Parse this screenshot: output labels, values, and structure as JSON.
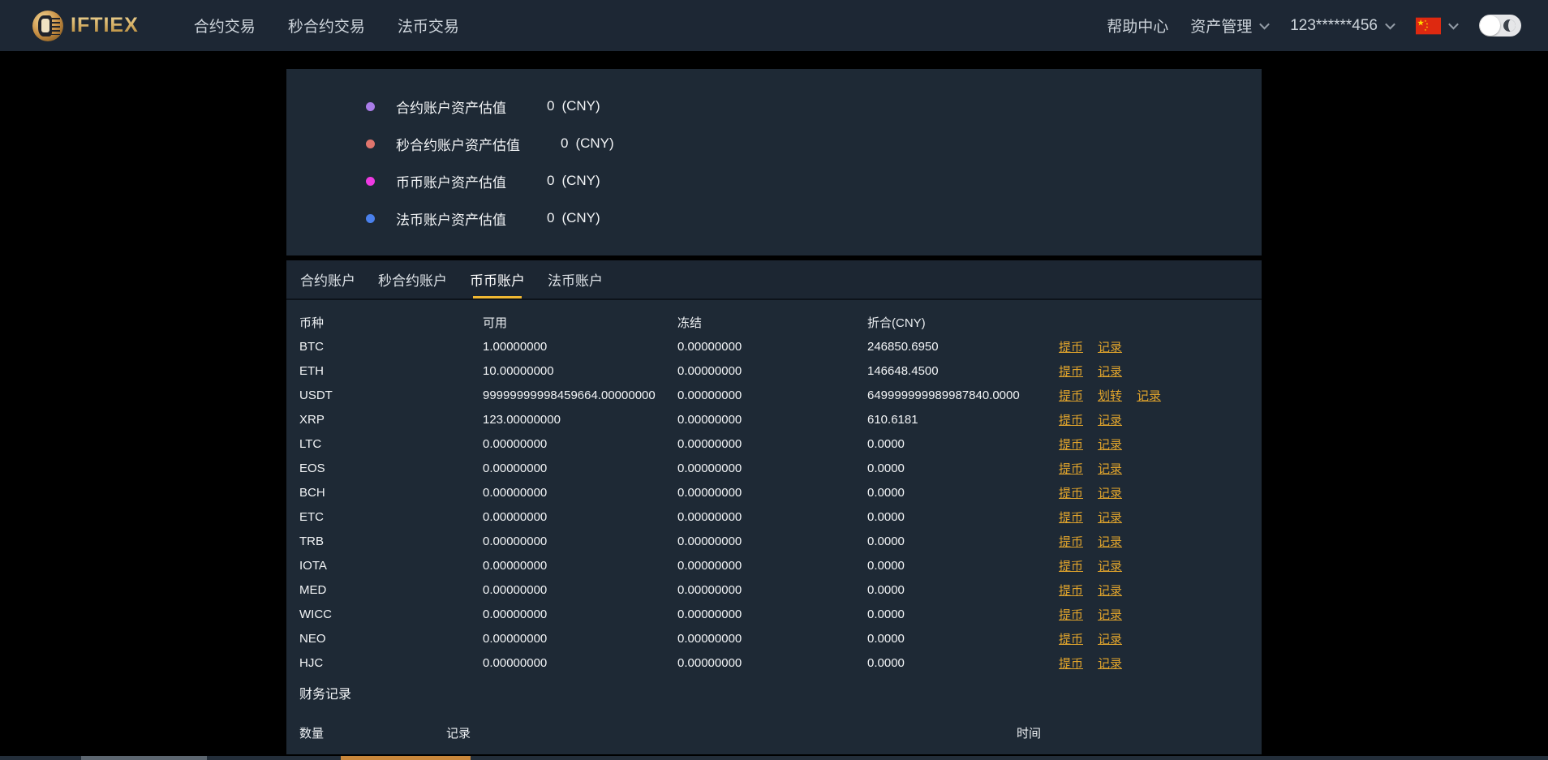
{
  "colors": {
    "page_bg": "#000000",
    "navbar_bg": "#1d2734",
    "panel_bg": "#1e2935",
    "accent_gold": "#f0b832",
    "link_gold": "#e2a52c",
    "flag_red": "#de2910",
    "flag_yellow": "#ffde00",
    "strip_gray": "#5c6670",
    "strip_orange": "#c9873b"
  },
  "navbar": {
    "brand": "IFTIEX",
    "left_items": [
      {
        "label": "合约交易"
      },
      {
        "label": "秒合约交易"
      },
      {
        "label": "法币交易"
      }
    ],
    "help": "帮助中心",
    "assets_menu": "资产管理",
    "account": "123******456"
  },
  "summary": {
    "rows": [
      {
        "label": "合约账户资产估值",
        "value": "0",
        "unit": "(CNY)",
        "dot_color": "#a97ce8"
      },
      {
        "label": "秒合约账户资产估值",
        "value": "0",
        "unit": "(CNY)",
        "dot_color": "#e0756d"
      },
      {
        "label": "币币账户资产估值",
        "value": "0",
        "unit": "(CNY)",
        "dot_color": "#ee3ae2"
      },
      {
        "label": "法币账户资产估值",
        "value": "0",
        "unit": "(CNY)",
        "dot_color": "#4a80ec"
      }
    ]
  },
  "tabs": [
    {
      "label": "合约账户",
      "active": false
    },
    {
      "label": "秒合约账户",
      "active": false
    },
    {
      "label": "币币账户",
      "active": true
    },
    {
      "label": "法币账户",
      "active": false
    }
  ],
  "balances": {
    "headers": {
      "coin": "币种",
      "available": "可用",
      "frozen": "冻结",
      "cny": "折合(CNY)"
    },
    "rows": [
      {
        "coin": "BTC",
        "available": "1.00000000",
        "frozen": "0.00000000",
        "cny": "246850.6950",
        "actions": [
          "提币",
          "记录"
        ]
      },
      {
        "coin": "ETH",
        "available": "10.00000000",
        "frozen": "0.00000000",
        "cny": "146648.4500",
        "actions": [
          "提币",
          "记录"
        ]
      },
      {
        "coin": "USDT",
        "available": "99999999998459664.00000000",
        "frozen": "0.00000000",
        "cny": "649999999989987840.0000",
        "actions": [
          "提币",
          "划转",
          "记录"
        ]
      },
      {
        "coin": "XRP",
        "available": "123.00000000",
        "frozen": "0.00000000",
        "cny": "610.6181",
        "actions": [
          "提币",
          "记录"
        ]
      },
      {
        "coin": "LTC",
        "available": "0.00000000",
        "frozen": "0.00000000",
        "cny": "0.0000",
        "actions": [
          "提币",
          "记录"
        ]
      },
      {
        "coin": "EOS",
        "available": "0.00000000",
        "frozen": "0.00000000",
        "cny": "0.0000",
        "actions": [
          "提币",
          "记录"
        ]
      },
      {
        "coin": "BCH",
        "available": "0.00000000",
        "frozen": "0.00000000",
        "cny": "0.0000",
        "actions": [
          "提币",
          "记录"
        ]
      },
      {
        "coin": "ETC",
        "available": "0.00000000",
        "frozen": "0.00000000",
        "cny": "0.0000",
        "actions": [
          "提币",
          "记录"
        ]
      },
      {
        "coin": "TRB",
        "available": "0.00000000",
        "frozen": "0.00000000",
        "cny": "0.0000",
        "actions": [
          "提币",
          "记录"
        ]
      },
      {
        "coin": "IOTA",
        "available": "0.00000000",
        "frozen": "0.00000000",
        "cny": "0.0000",
        "actions": [
          "提币",
          "记录"
        ]
      },
      {
        "coin": "MED",
        "available": "0.00000000",
        "frozen": "0.00000000",
        "cny": "0.0000",
        "actions": [
          "提币",
          "记录"
        ]
      },
      {
        "coin": "WICC",
        "available": "0.00000000",
        "frozen": "0.00000000",
        "cny": "0.0000",
        "actions": [
          "提币",
          "记录"
        ]
      },
      {
        "coin": "NEO",
        "available": "0.00000000",
        "frozen": "0.00000000",
        "cny": "0.0000",
        "actions": [
          "提币",
          "记录"
        ]
      },
      {
        "coin": "HJC",
        "available": "0.00000000",
        "frozen": "0.00000000",
        "cny": "0.0000",
        "actions": [
          "提币",
          "记录"
        ]
      }
    ]
  },
  "records": {
    "title": "财务记录",
    "headers": {
      "amount": "数量",
      "record": "记录",
      "time": "时间"
    }
  }
}
